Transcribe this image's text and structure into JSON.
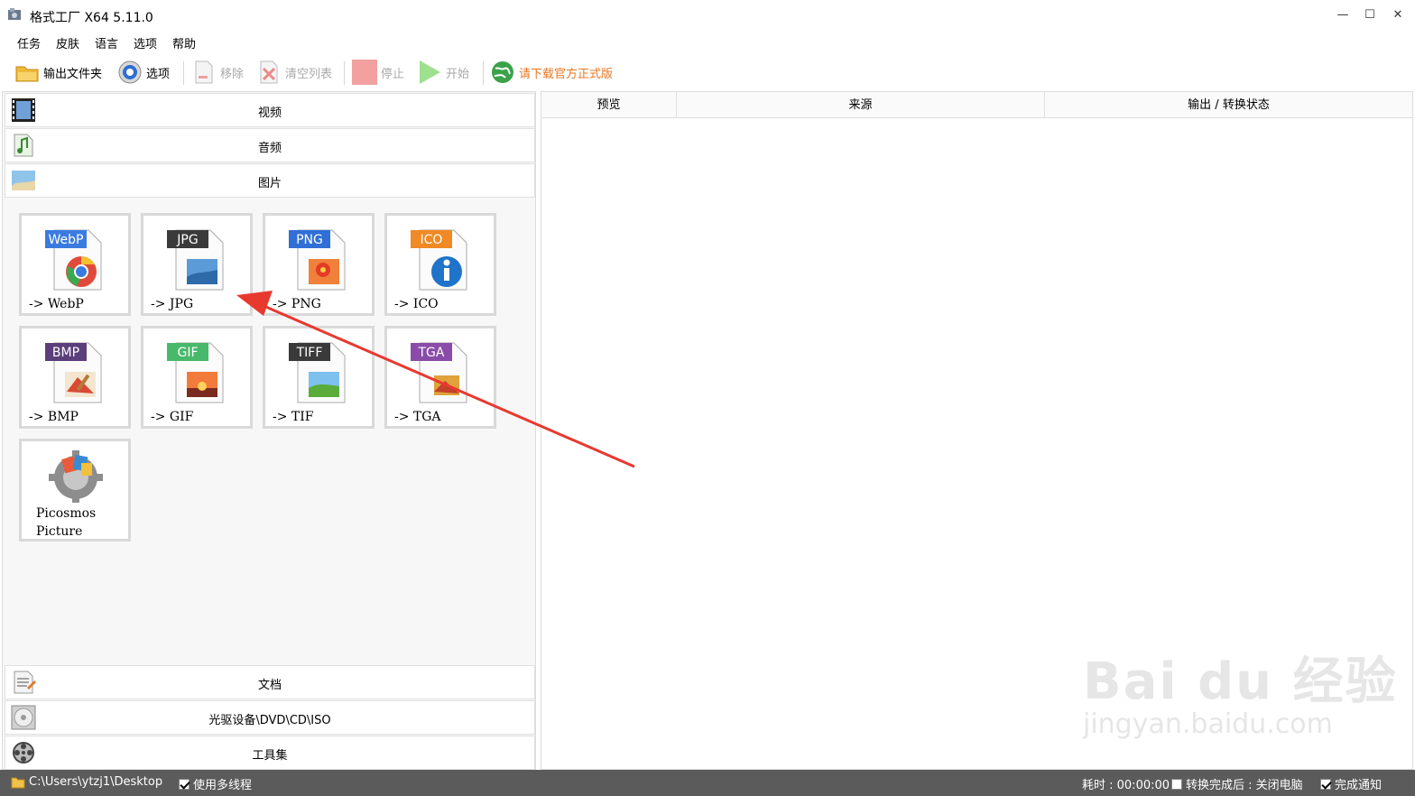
{
  "window": {
    "title": "格式工厂 X64 5.11.0",
    "minimize_label": "—",
    "maximize_label": "☐",
    "close_label": "✕"
  },
  "menu": {
    "items": [
      "任务",
      "皮肤",
      "语言",
      "选项",
      "帮助"
    ]
  },
  "toolbar": {
    "output_folder": "输出文件夹",
    "options": "选项",
    "remove": "移除",
    "clear_list": "清空列表",
    "stop": "停止",
    "start": "开始",
    "download_official": "请下载官方正式版"
  },
  "categories": {
    "video": "视频",
    "audio": "音频",
    "picture": "图片",
    "document": "文档",
    "disc": "光驱设备\\DVD\\CD\\ISO",
    "tools": "工具集"
  },
  "tiles": [
    {
      "badge": "WebP",
      "label": "-> WebP",
      "badge_color": "#3b7be0"
    },
    {
      "badge": "JPG",
      "label": "-> JPG",
      "badge_color": "#3a3a3a"
    },
    {
      "badge": "PNG",
      "label": "-> PNG",
      "badge_color": "#2f6fd6"
    },
    {
      "badge": "ICO",
      "label": "-> ICO",
      "badge_color": "#f08a24"
    },
    {
      "badge": "BMP",
      "label": "-> BMP",
      "badge_color": "#5b3f7a"
    },
    {
      "badge": "GIF",
      "label": "-> GIF",
      "badge_color": "#48b86a"
    },
    {
      "badge": "TIFF",
      "label": "-> TIF",
      "badge_color": "#3a3a3a"
    },
    {
      "badge": "TGA",
      "label": "-> TGA",
      "badge_color": "#8a4ca8"
    }
  ],
  "picosmos": {
    "line1": "Picosmos",
    "line2": "Picture"
  },
  "table": {
    "columns": [
      "预览",
      "来源",
      "输出 / 转换状态"
    ]
  },
  "status": {
    "path": "C:\\Users\\ytzj1\\Desktop",
    "multithread": "使用多线程",
    "elapsed": "耗时 : 00:00:00",
    "after_convert": "转换完成后 : 关闭电脑",
    "notify": "完成通知"
  },
  "watermark": {
    "main": "Bai du 经验",
    "sub": "jingyan.baidu.com"
  }
}
